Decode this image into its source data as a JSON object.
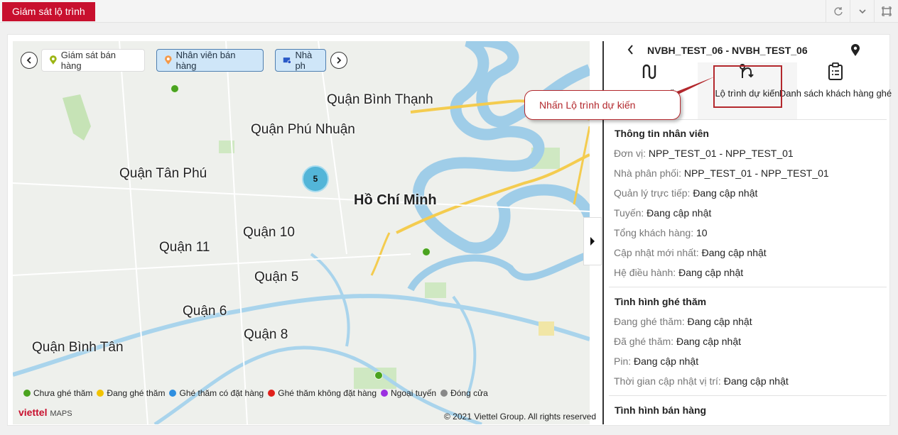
{
  "app": {
    "tab_title": "Giám sát lộ trình"
  },
  "map": {
    "chips": [
      "Giám sát bán hàng",
      "Nhân viên bán hàng",
      "Nhà ph"
    ],
    "labels": {
      "binh_thanh": "Quận Bình Thạnh",
      "phu_nhuan": "Quận Phú Nhuận",
      "tan_phu": "Quận Tân Phú",
      "hcm": "Hồ Chí Minh",
      "q10": "Quận 10",
      "q11": "Quận 11",
      "q5": "Quận 5",
      "q6": "Quận 6",
      "q8": "Quận 8",
      "binh_tan": "Quận Bình Tân"
    },
    "cluster_count": "5",
    "legend": [
      {
        "label": "Chưa ghé thăm",
        "color": "#4aa31f"
      },
      {
        "label": "Đang ghé thăm",
        "color": "#f2c300"
      },
      {
        "label": "Ghé thăm có đặt hàng",
        "color": "#2f8fe0"
      },
      {
        "label": "Ghé thăm không đặt hàng",
        "color": "#e0201b"
      },
      {
        "label": "Ngoại tuyến",
        "color": "#9b30e0"
      },
      {
        "label": "Đóng cửa",
        "color": "#888888"
      }
    ],
    "brand": "viettel",
    "brand_suffix": "MAPS",
    "copyright": "© 2021 Viettel Group. All rights reserved"
  },
  "panel": {
    "header": "NVBH_TEST_06 - NVBH_TEST_06",
    "actions": {
      "route_actual_partial": "ế",
      "route_planned": "Lộ trình dự kiến",
      "customer_list": "Danh sách khách hàng ghé"
    },
    "callout": "Nhấn Lộ trình dự kiến",
    "employee_info": {
      "title": "Thông tin nhân viên",
      "rows": [
        {
          "label": "Đơn vị:",
          "value": "NPP_TEST_01 - NPP_TEST_01"
        },
        {
          "label": "Nhà phân phối:",
          "value": "NPP_TEST_01 - NPP_TEST_01"
        },
        {
          "label": "Quản lý trực tiếp:",
          "value": "Đang cập nhật"
        },
        {
          "label": "Tuyến:",
          "value": "Đang cập nhật"
        },
        {
          "label": "Tổng khách hàng:",
          "value": "10"
        },
        {
          "label": "Cập nhật mới nhất:",
          "value": "Đang cập nhật"
        },
        {
          "label": "Hệ điều hành:",
          "value": "Đang cập nhật"
        }
      ]
    },
    "visit_status": {
      "title": "Tình hình ghé thăm",
      "rows": [
        {
          "label": "Đang ghé thăm:",
          "value": "Đang cập nhật"
        },
        {
          "label": "Đã ghé thăm:",
          "value": "Đang cập nhật"
        },
        {
          "label": "Pin:",
          "value": "Đang cập nhật"
        },
        {
          "label": "Thời gian cập nhật vị trí:",
          "value": "Đang cập nhật"
        }
      ]
    },
    "sales_status": {
      "title": "Tình hình bán hàng"
    }
  }
}
